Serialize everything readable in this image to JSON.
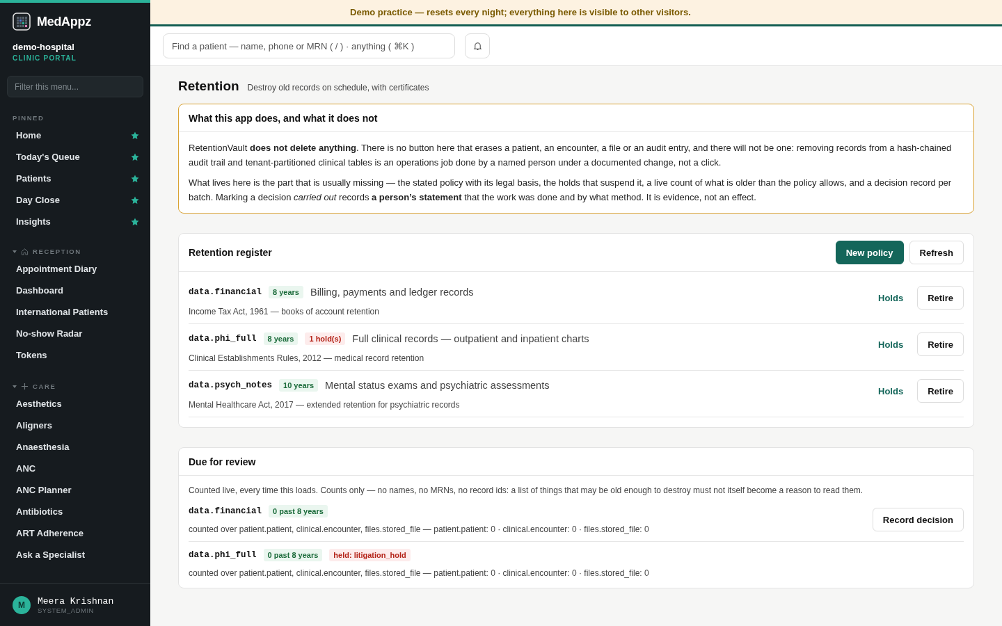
{
  "brand": {
    "name": "MedAppz",
    "tenant": "demo-hospital",
    "portal": "CLINIC PORTAL"
  },
  "sidebar": {
    "filter": {
      "placeholder": "Filter this menu..."
    },
    "groups": [
      {
        "label": "PINNED",
        "items": [
          {
            "label": "Home",
            "starred": true
          },
          {
            "label": "Today's Queue",
            "starred": true
          },
          {
            "label": "Patients",
            "starred": true
          },
          {
            "label": "Day Close",
            "starred": true
          },
          {
            "label": "Insights",
            "starred": true
          }
        ]
      },
      {
        "label": "RECEPTION",
        "expanded": true,
        "items": [
          {
            "label": "Appointment Diary",
            "starred": false
          },
          {
            "label": "Dashboard",
            "starred": false
          },
          {
            "label": "International Patients",
            "starred": false
          },
          {
            "label": "No-show Radar",
            "starred": false
          },
          {
            "label": "Tokens",
            "starred": false
          }
        ]
      },
      {
        "label": "CARE",
        "expanded": true,
        "items": [
          {
            "label": "Aesthetics",
            "starred": false
          },
          {
            "label": "Aligners",
            "starred": false
          },
          {
            "label": "Anaesthesia",
            "starred": false
          },
          {
            "label": "ANC",
            "starred": false
          },
          {
            "label": "ANC Planner",
            "starred": false
          },
          {
            "label": "Antibiotics",
            "starred": false
          },
          {
            "label": "ART Adherence",
            "starred": false
          },
          {
            "label": "Ask a Specialist",
            "starred": false
          }
        ]
      }
    ],
    "user": {
      "initial": "M",
      "name": "Meera Krishnan",
      "role": "SYSTEM_ADMIN"
    }
  },
  "banner": "Demo practice — resets every night; everything here is visible to other visitors.",
  "search": {
    "placeholder": "Find a patient — name, phone or MRN ( / ) · anything ( ⌘K )"
  },
  "page": {
    "title": "Retention",
    "subtitle": "Destroy old records on schedule, with certificates"
  },
  "notice": {
    "title": "What this app does, and what it does not",
    "paragraphs": [
      "RetentionVault **does not delete anything**. There is no button here that erases a patient, an encounter, a file or an audit entry, and there will not be one: removing records from a hash-chained audit trail and tenant-partitioned clinical tables is an operations job done by a named person under a documented change, not a click.",
      "What lives here is the part that is usually missing — the stated policy with its legal basis, the holds that suspend it, a live count of what is older than the policy allows, and a decision record per batch. Marking a decision *carried out* records **a person’s statement** that the work was done and by what method. It is evidence, not an effect."
    ]
  },
  "register": {
    "title": "Retention register",
    "buttons": [
      {
        "label": "New policy",
        "kind": "primary"
      },
      {
        "label": "Refresh",
        "kind": "secondary"
      }
    ],
    "rows": [
      {
        "key": "data.financial",
        "tags": [
          {
            "text": "8 years",
            "kind": "good"
          }
        ],
        "description": "Billing, payments and ledger records",
        "basis": "Income Tax Act, 1961 — books of account retention",
        "link": "Holds",
        "action": "Retire"
      },
      {
        "key": "data.phi_full",
        "tags": [
          {
            "text": "8 years",
            "kind": "good"
          },
          {
            "text": "1 hold(s)",
            "kind": "alert"
          }
        ],
        "description": "Full clinical records — outpatient and inpatient charts",
        "basis": "Clinical Establishments Rules, 2012 — medical record retention",
        "link": "Holds",
        "action": "Retire"
      },
      {
        "key": "data.psych_notes",
        "tags": [
          {
            "text": "10 years",
            "kind": "good"
          }
        ],
        "description": "Mental status exams and psychiatric assessments",
        "basis": "Mental Healthcare Act, 2017 — extended retention for psychiatric records",
        "link": "Holds",
        "action": "Retire"
      }
    ]
  },
  "review": {
    "title": "Due for review",
    "intro": "Counted live, every time this loads. Counts only — no names, no MRNs, no record ids: a list of things that may be old enough to destroy must not itself become a reason to read them.",
    "rows": [
      {
        "key": "data.financial",
        "tags": [
          {
            "text": "0 past 8 years",
            "kind": "good"
          }
        ],
        "detail": "counted over patient.patient, clinical.encounter, files.stored_file — patient.patient: 0 · clinical.encounter: 0 · files.stored_file: 0",
        "action": "Record decision"
      },
      {
        "key": "data.phi_full",
        "tags": [
          {
            "text": "0 past 8 years",
            "kind": "good"
          },
          {
            "text": "held: litigation_hold",
            "kind": "alert"
          }
        ],
        "detail": "counted over patient.patient, clinical.encounter, files.stored_file — patient.patient: 0 · clinical.encounter: 0 · files.stored_file: 0"
      }
    ]
  }
}
